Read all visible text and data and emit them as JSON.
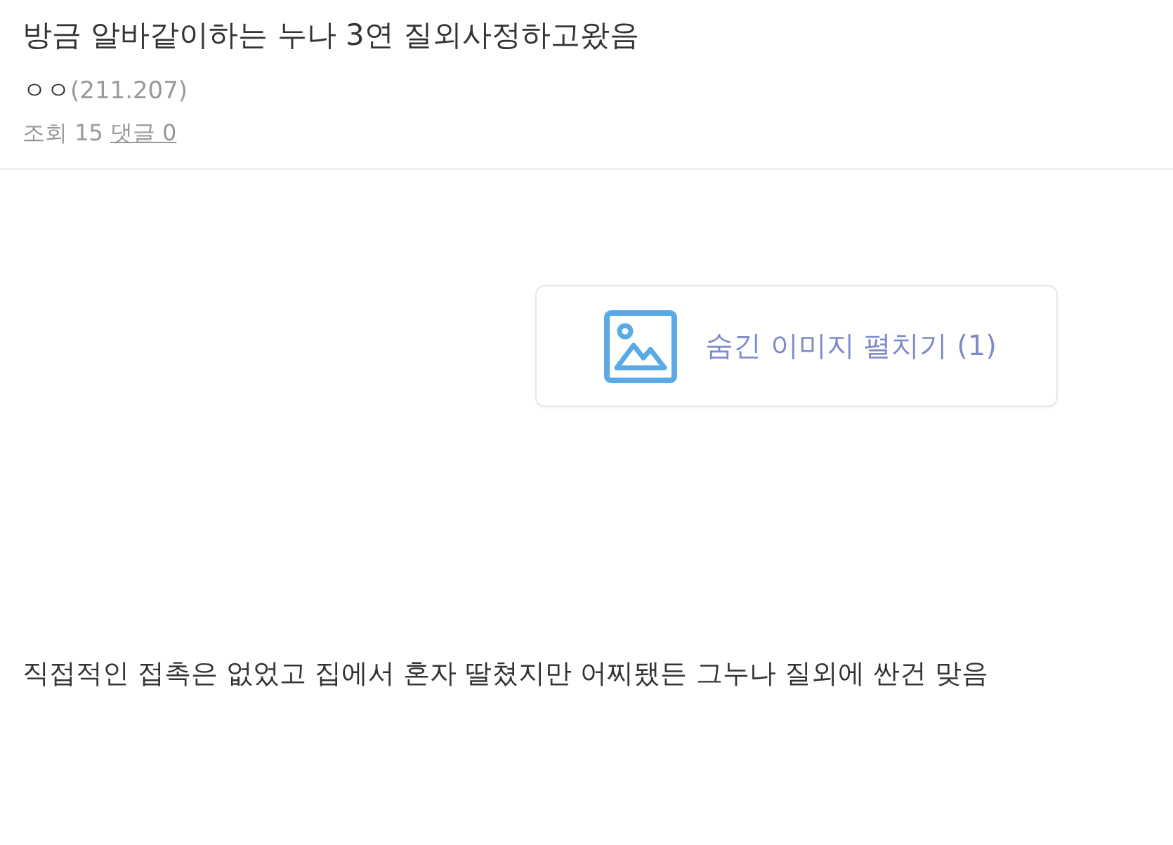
{
  "post": {
    "title": "방금 알바같이하는 누나 3연 질외사정하고왔음",
    "author": {
      "nickname": "ㅇㅇ",
      "ip": "(211.207)"
    },
    "stats": [
      {
        "kind": "text",
        "label": "조회 15"
      },
      {
        "kind": "link",
        "label": "댓글 0"
      }
    ]
  },
  "hidden_images_button": {
    "label": "숨긴 이미지 펼치기 (1)"
  },
  "body": {
    "paragraphs": [
      "직접적인 접촉은 없었고 집에서 혼자 딸쳤지만 어찌됐든 그누나 질외에 싼건 맞음"
    ]
  }
}
